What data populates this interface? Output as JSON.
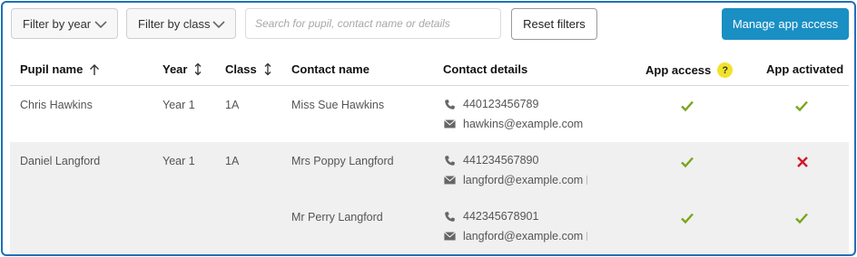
{
  "filters": {
    "year_label": "Filter by year",
    "class_label": "Filter by class",
    "search_placeholder": "Search for pupil, contact name or details",
    "reset_label": "Reset filters"
  },
  "actions": {
    "manage_label": "Manage app access"
  },
  "table": {
    "columns": {
      "pupil": "Pupil name",
      "year": "Year",
      "class": "Class",
      "contact_name": "Contact name",
      "contact_details": "Contact details",
      "app_access": "App access",
      "app_activated": "App activated"
    },
    "help_glyph": "?",
    "rows": [
      {
        "pupil": "Chris Hawkins",
        "year": "Year 1",
        "class": "1A",
        "contacts": [
          {
            "name": "Miss Sue Hawkins",
            "phone": "440123456789",
            "email": "hawkins@example.com",
            "app_access": true,
            "app_activated": true
          }
        ]
      },
      {
        "pupil": "Daniel Langford",
        "year": "Year 1",
        "class": "1A",
        "contacts": [
          {
            "name": "Mrs Poppy Langford",
            "phone": "441234567890",
            "email": "langford@example.com",
            "app_access": true,
            "app_activated": false
          },
          {
            "name": "Mr Perry Langford",
            "phone": "442345678901",
            "email": "langford@example.com",
            "app_access": true,
            "app_activated": true
          }
        ]
      }
    ]
  },
  "colors": {
    "accent": "#1a8fc4",
    "frame_border": "#1f6fb8",
    "check": "#7aa51e",
    "cross": "#d0192b",
    "help_badge": "#f2e22b"
  },
  "icons": {
    "sort_asc": "arrow-up-icon",
    "sort_both": "sort-icon",
    "phone": "phone-icon",
    "email": "envelope-icon",
    "dropdown": "chevron-down-icon",
    "yes": "check-icon",
    "no": "cross-icon"
  }
}
